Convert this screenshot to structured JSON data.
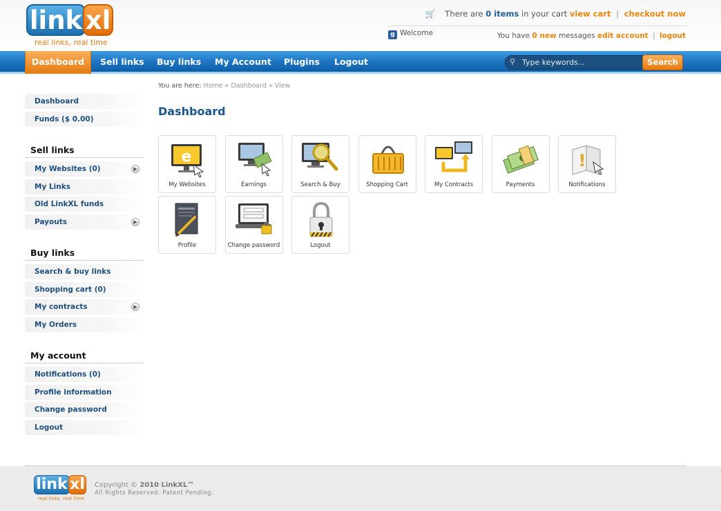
{
  "logo": {
    "main": "link",
    "accent": "xl",
    "tagline": "real links, real time"
  },
  "header": {
    "cart_prefix": "There are",
    "cart_count": "0 items",
    "cart_suffix": "in your cart",
    "view_cart": "view cart",
    "separator": "|",
    "checkout": "checkout now",
    "welcome": "Welcome",
    "msg_prefix": "You have",
    "msg_count": "0 new",
    "msg_suffix": "messages",
    "edit_account": "edit account",
    "logout": "logout"
  },
  "nav": {
    "items": [
      "Dashboard",
      "Sell links",
      "Buy links",
      "My Account",
      "Plugins",
      "Logout"
    ],
    "search_placeholder": "Type keywords...",
    "search_button": "Search"
  },
  "sidebar": {
    "top": [
      "Dashboard",
      "Funds ($ 0.00)"
    ],
    "sell_title": "Sell links",
    "sell": [
      "My Websites (0)",
      "My Links",
      "Old LinkXL funds",
      "Payouts"
    ],
    "buy_title": "Buy links",
    "buy": [
      "Search & buy links",
      "Shopping cart (0)",
      "My contracts",
      "My Orders"
    ],
    "account_title": "My account",
    "account": [
      "Notifications (0)",
      "Profile information",
      "Change password",
      "Logout"
    ]
  },
  "breadcrumb": {
    "prefix": "You are here:",
    "items": [
      "Home",
      "Dashboard",
      "View"
    ],
    "sep": "»"
  },
  "page_title": "Dashboard",
  "tiles": [
    "My Websites",
    "Earnings",
    "Search & Buy",
    "Shopping Cart",
    "My Contracts",
    "Payments",
    "Notifications",
    "Profile",
    "Change password",
    "Logout"
  ],
  "footer": {
    "logo_main": "link",
    "logo_accent": "xl",
    "tagline": "real links, real time",
    "copyright_prefix": "Copyright ©",
    "copyright_year_name": "2010 LinkXL™",
    "rights": "All Rights Reserved. Patent Pending."
  },
  "colors": {
    "brand_blue": "#1c73c0",
    "brand_orange": "#e67a10",
    "link_blue": "#1d4f7e"
  }
}
